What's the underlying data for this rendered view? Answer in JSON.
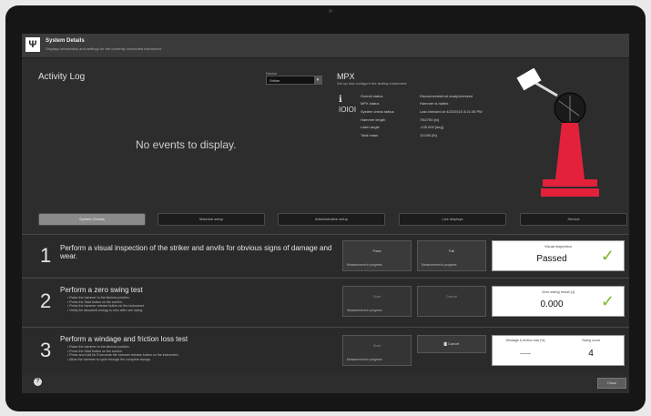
{
  "app": {
    "title": "System Details",
    "subtitle": "Displays information and settings for the currently connected instrument.",
    "icon": "fork-knife-icon"
  },
  "activity_log": {
    "title": "Activity Log",
    "empty_message": "No events to display."
  },
  "device": {
    "label": "Device",
    "selected": "Striker"
  },
  "mpx": {
    "title": "MPX",
    "subtitle": "Set up and configure the testing instrument.",
    "status": [
      {
        "key": "Overall status",
        "value": "Disconnected/not ready/checked"
      },
      {
        "key": "MPX status",
        "value": "Hammer is halted"
      },
      {
        "key": "System check status",
        "value": "Last checked at 4/22/2015 3:21:35 PM"
      },
      {
        "key": "Hammer length",
        "value": "750/750 [in]"
      },
      {
        "key": "Latch angle",
        "value": "-135.000 [deg]"
      },
      {
        "key": "Total mass",
        "value": "10.000 [lb]"
      }
    ]
  },
  "colors": {
    "accent_green": "#7bb928",
    "pendulum_red": "#e3213b"
  },
  "tabs": [
    {
      "label": "System Checks",
      "active": true
    },
    {
      "label": "Machine setup",
      "active": false
    },
    {
      "label": "Administrative setup",
      "active": false
    },
    {
      "label": "Live displays",
      "active": false
    },
    {
      "label": "Service",
      "active": false
    }
  ],
  "steps": [
    {
      "number": "1",
      "title": "Perform a visual inspection of the striker and anvils for obvious signs of damage and wear.",
      "buttons": [
        {
          "label": "Pass",
          "note": "Measurement in progress"
        },
        {
          "label": "Fail",
          "note": "Measurement in progress"
        }
      ],
      "result": {
        "label": "Visual inspection",
        "value": "Passed"
      }
    },
    {
      "number": "2",
      "title": "Perform a zero swing test",
      "items": [
        "Raise the hammer to the latched position.",
        "Press the Start button on the screen.",
        "Press the hammer release button on the instrument.",
        "Verify the absorbed energy is zero after one swing."
      ],
      "buttons": [
        {
          "label": "Start",
          "note": "Measurement in progress"
        },
        {
          "label": "Cancel",
          "note": ""
        }
      ],
      "result": {
        "label": "Zero swing result [J]",
        "value": "0.000"
      }
    },
    {
      "number": "3",
      "title": "Perform a windage and friction loss test",
      "items": [
        "Raise the hammer to the latched position.",
        "Press the Start button on the screen.",
        "Press and hold for 5 seconds the hammer release button on the instrument.",
        "Allow the hammer to cycle through the complete swings."
      ],
      "buttons": [
        {
          "label": "Start",
          "note": "Measurement in progress"
        },
        {
          "label": "Cancel",
          "note": ""
        }
      ],
      "result": {
        "label_left": "Windage & friction loss [%]",
        "value_left": "------",
        "label_right": "Swing count",
        "value_right": "4"
      }
    }
  ],
  "footer": {
    "close_label": "Close",
    "help_glyph": "?"
  }
}
